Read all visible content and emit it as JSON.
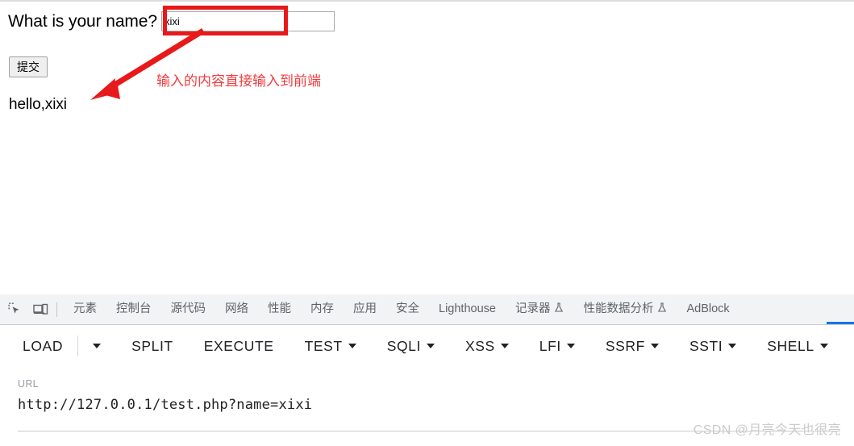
{
  "page": {
    "question_label": "What is your name?",
    "name_input_value": "xixi",
    "name_input_placeholder": "",
    "submit_button": "提交",
    "output_text": "hello,xixi"
  },
  "annotation": {
    "note_text": "输入的内容直接输入到前端",
    "box_color": "#e8191b",
    "arrow_color": "#e8191b",
    "text_color": "#f33b3d"
  },
  "devtools": {
    "icons": [
      {
        "name": "inspect-element-icon"
      },
      {
        "name": "device-toolbar-icon"
      }
    ],
    "tabs": [
      {
        "label": "元素",
        "flask": false
      },
      {
        "label": "控制台",
        "flask": false
      },
      {
        "label": "源代码",
        "flask": false
      },
      {
        "label": "网络",
        "flask": false
      },
      {
        "label": "性能",
        "flask": false
      },
      {
        "label": "内存",
        "flask": false
      },
      {
        "label": "应用",
        "flask": false
      },
      {
        "label": "安全",
        "flask": false
      },
      {
        "label": "Lighthouse",
        "flask": false
      },
      {
        "label": "记录器",
        "flask": true
      },
      {
        "label": "性能数据分析",
        "flask": true
      },
      {
        "label": "AdBlock",
        "flask": false
      }
    ],
    "active_indicator_color": "#1a73e8",
    "tabbar_bg": "#f1f3f4",
    "tab_text_color": "#5f6368"
  },
  "hackbar": {
    "items": [
      {
        "label": "LOAD",
        "caret": false,
        "standalone_caret": true
      },
      {
        "label": "SPLIT",
        "caret": false,
        "standalone_caret": false
      },
      {
        "label": "EXECUTE",
        "caret": false,
        "standalone_caret": false
      },
      {
        "label": "TEST",
        "caret": true,
        "standalone_caret": false
      },
      {
        "label": "SQLI",
        "caret": true,
        "standalone_caret": false
      },
      {
        "label": "XSS",
        "caret": true,
        "standalone_caret": false
      },
      {
        "label": "LFI",
        "caret": true,
        "standalone_caret": false
      },
      {
        "label": "SSRF",
        "caret": true,
        "standalone_caret": false
      },
      {
        "label": "SSTI",
        "caret": true,
        "standalone_caret": false
      },
      {
        "label": "SHELL",
        "caret": true,
        "standalone_caret": false
      }
    ],
    "text_color": "#202124"
  },
  "url_panel": {
    "label": "URL",
    "value": "http://127.0.0.1/test.php?name=xixi"
  },
  "watermark": {
    "text": "CSDN @月亮今天也很亮"
  }
}
